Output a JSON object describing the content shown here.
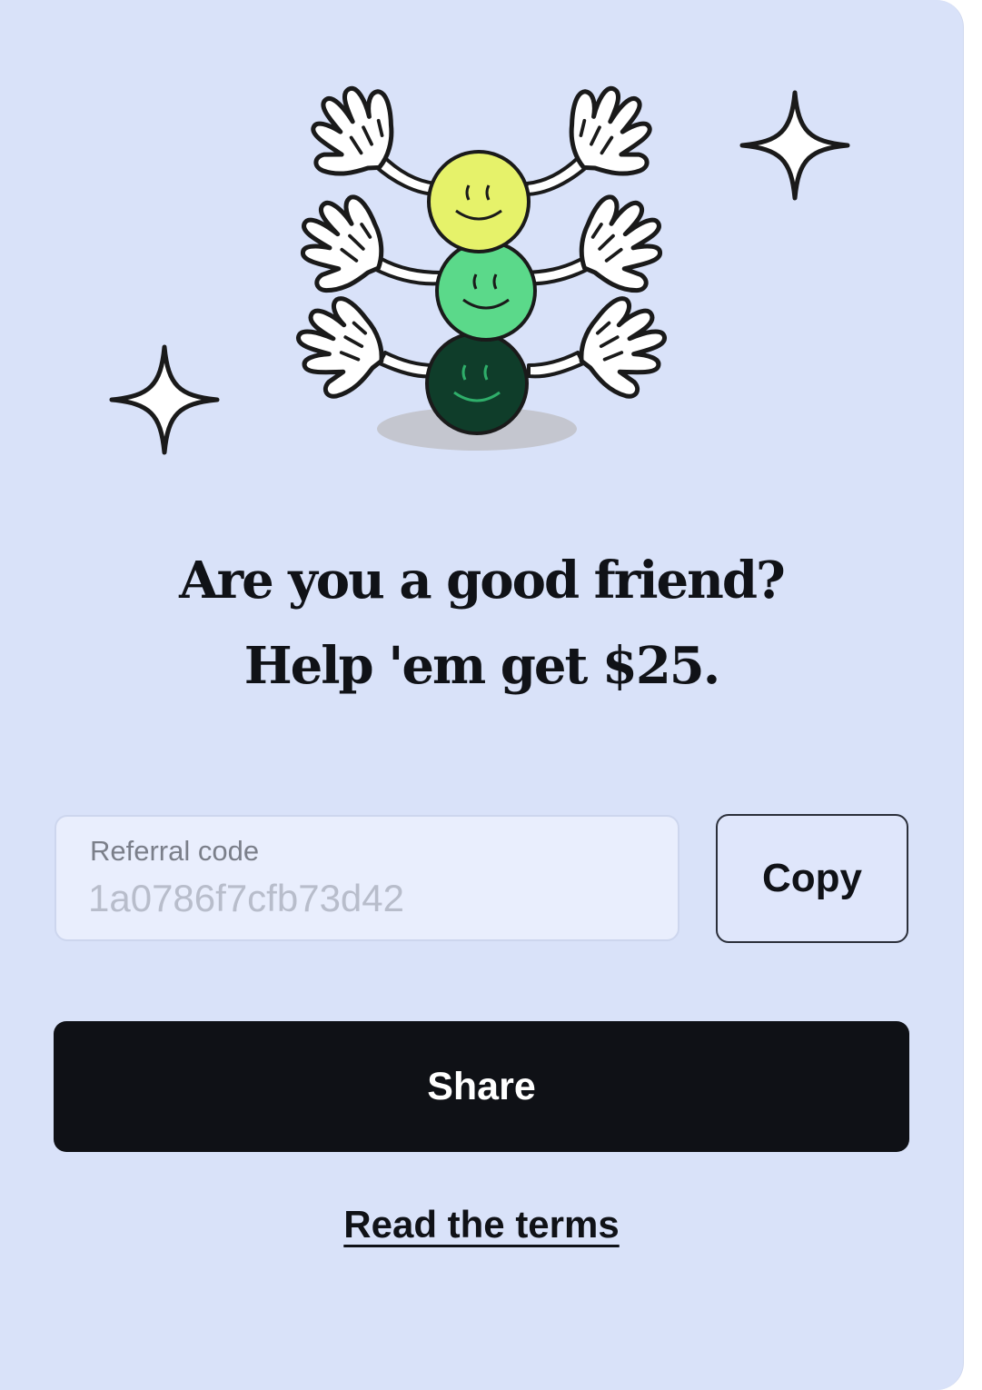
{
  "headline": {
    "line1": "Are you a good friend?",
    "line2": "Help 'em get $25."
  },
  "referral": {
    "label": "Referral code",
    "value": "1a0786f7cfb73d42"
  },
  "buttons": {
    "copy_label": "Copy",
    "share_label": "Share",
    "terms_label": "Read the terms"
  },
  "illustration": {
    "icon_names": [
      "sparkle-icon",
      "smiley-stack-illustration",
      "waving-glove-icon"
    ],
    "smiley_colors": [
      "#e6f26a",
      "#5bd98a",
      "#0f3d2a"
    ]
  },
  "colors": {
    "card_background": "#d9e2f9",
    "primary_button": "#0f1116",
    "text": "#101217"
  }
}
